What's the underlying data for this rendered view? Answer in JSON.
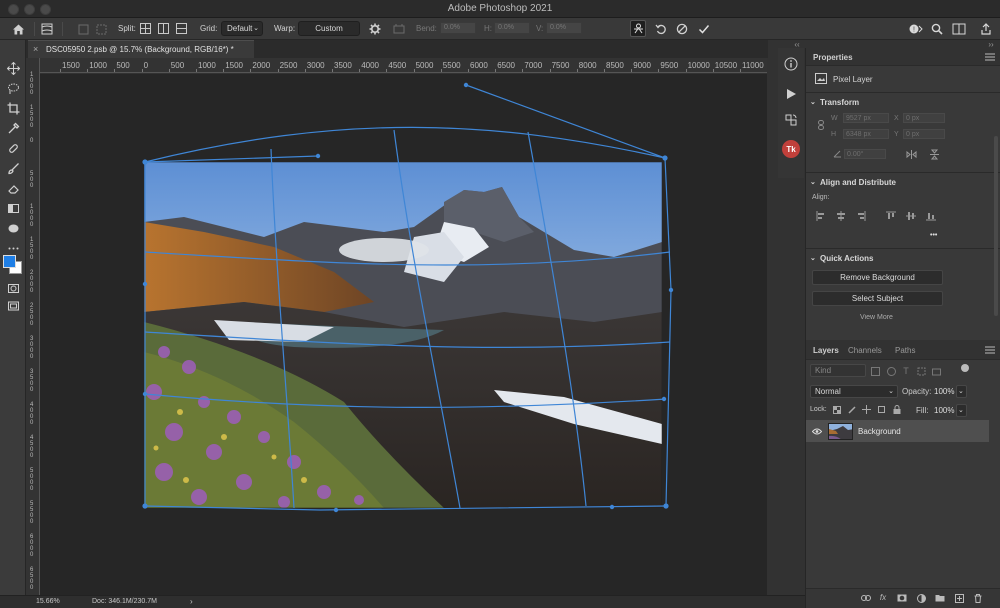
{
  "app": {
    "title": "Adobe Photoshop 2021"
  },
  "options_bar": {
    "split_label": "Split:",
    "grid_label": "Grid:",
    "grid_value": "Default",
    "warp_label": "Warp:",
    "warp_value": "Custom",
    "bend_label": "Bend:",
    "bend_value": "0.0%",
    "h_label": "H:",
    "h_value": "0.0%",
    "v_label": "V:",
    "v_value": "0.0%"
  },
  "document": {
    "tab_title": "DSC05950 2.psb @ 15.7% (Background, RGB/16*) *",
    "close_glyph": "×"
  },
  "ruler": {
    "top_labels": [
      "1500",
      "1000",
      "500",
      "0",
      "500",
      "1000",
      "1500",
      "2000",
      "2500",
      "3000",
      "3500",
      "4000",
      "4500",
      "5000",
      "5500",
      "6000",
      "6500",
      "7000",
      "7500",
      "8000",
      "8500",
      "9000",
      "9500",
      "10000",
      "10500",
      "11000"
    ],
    "left_labels": [
      "1000",
      "1500",
      "0",
      "500",
      "1000",
      "1500",
      "2000",
      "2500",
      "3000",
      "3500",
      "4000",
      "4500",
      "5000",
      "5500",
      "6000",
      "6500"
    ]
  },
  "properties": {
    "tab": "Properties",
    "layer_type": "Pixel Layer",
    "transform_title": "Transform",
    "w_label": "W",
    "w_value": "9527 px",
    "h_label": "H",
    "h_value": "6348 px",
    "x_label": "X",
    "x_value": "0 px",
    "y_label": "Y",
    "y_value": "0 px",
    "angle_value": "0.00°",
    "align_title": "Align and Distribute",
    "align_label": "Align:",
    "more_glyph": "•••",
    "quick_actions_title": "Quick Actions",
    "remove_bg": "Remove Background",
    "select_subject": "Select Subject",
    "view_more": "View More"
  },
  "layers": {
    "tabs": [
      "Layers",
      "Channels",
      "Paths"
    ],
    "kind_placeholder": "Kind",
    "blend_mode": "Normal",
    "opacity_label": "Opacity:",
    "opacity_value": "100%",
    "lock_label": "Lock:",
    "fill_label": "Fill:",
    "fill_value": "100%",
    "layer_name": "Background"
  },
  "status": {
    "zoom": "15.66%",
    "doc_info": "Doc: 346.1M/230.7M",
    "arrow": "›"
  },
  "colors": {
    "accent": "#1f7fe6",
    "warp_lines": "#3f86d6",
    "foreground": "#1f7fe6",
    "background_swatch": "#ffffff"
  },
  "icons": {
    "home": "home-icon",
    "tools": [
      "move-icon",
      "lasso-icon",
      "crop-icon",
      "eyedropper-icon",
      "healing-brush-icon",
      "brush-icon",
      "eraser-icon",
      "gradient-icon",
      "blur-icon",
      "more-tools-icon"
    ]
  }
}
